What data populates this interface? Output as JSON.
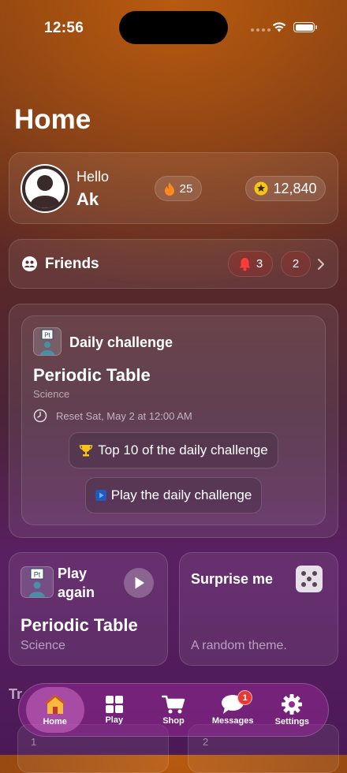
{
  "status_bar": {
    "time": "12:56"
  },
  "page": {
    "title": "Home"
  },
  "profile": {
    "greeting": "Hello",
    "username": "Ak",
    "streak": "25",
    "coins": "12,840"
  },
  "friends": {
    "label": "Friends",
    "notifications": "3",
    "requests": "2"
  },
  "daily_challenge": {
    "label": "Daily challenge",
    "icon_text": "Pt",
    "topic": "Periodic Table",
    "category": "Science",
    "reset_text": "Reset Sat, May 2 at 12:00 AM",
    "top10_button": "Top 10 of the daily challenge",
    "play_button": "Play the daily challenge"
  },
  "play_again": {
    "label": "Play again",
    "topic": "Periodic Table",
    "category": "Science"
  },
  "surprise": {
    "title": "Surprise me",
    "subtitle": "A random theme."
  },
  "trending": {
    "label_partial": "Tr",
    "items": [
      {
        "rank": "1"
      },
      {
        "rank": "2"
      }
    ]
  },
  "navbar": {
    "items": [
      {
        "label": "Home",
        "icon": "home-icon",
        "active": true
      },
      {
        "label": "Play",
        "icon": "grid-icon"
      },
      {
        "label": "Shop",
        "icon": "cart-icon"
      },
      {
        "label": "Messages",
        "icon": "chat-icon",
        "badge": "1"
      },
      {
        "label": "Settings",
        "icon": "gear-icon"
      }
    ]
  },
  "colors": {
    "navbar": "#96289a",
    "badge": "#e53935",
    "coin": "#f5c518",
    "flame": "#ff8a1a"
  }
}
